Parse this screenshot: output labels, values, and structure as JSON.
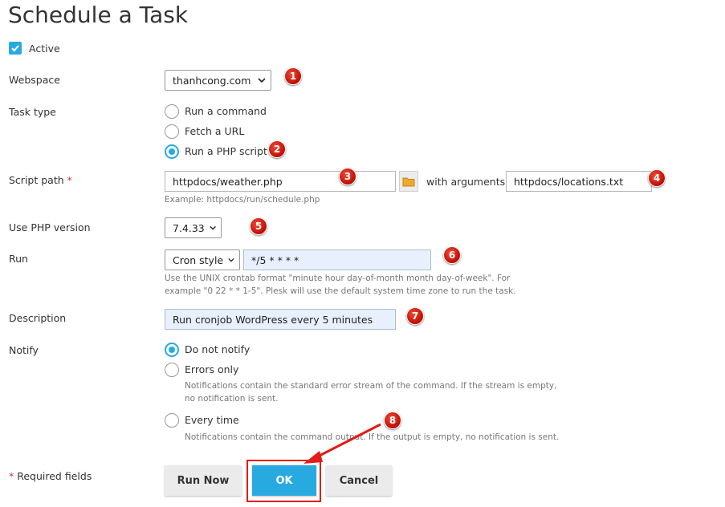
{
  "page": {
    "title": "Schedule a Task"
  },
  "active": {
    "label": "Active",
    "checked": true
  },
  "webspace": {
    "label": "Webspace",
    "value": "thanhcong.com"
  },
  "task_type": {
    "label": "Task type",
    "options": [
      "Run a command",
      "Fetch a URL",
      "Run a PHP script"
    ],
    "selected": "Run a PHP script"
  },
  "script_path": {
    "label": "Script path",
    "required_mark": "*",
    "value": "httpdocs/weather.php",
    "example": "Example: httpdocs/run/schedule.php",
    "arguments_label": "with arguments",
    "arguments_value": "httpdocs/locations.txt"
  },
  "php_version": {
    "label": "Use PHP version",
    "value": "7.4.33"
  },
  "run": {
    "label": "Run",
    "style_value": "Cron style",
    "cron_value": "*/5 * * * *",
    "hint_line1": "Use the UNIX crontab format \"minute hour day-of-month month day-of-week\". For",
    "hint_line2": "example \"0 22 * * 1-5\". Plesk will use the default system time zone to run the task."
  },
  "description": {
    "label": "Description",
    "value": "Run cronjob WordPress every 5 minutes"
  },
  "notify": {
    "label": "Notify",
    "options": {
      "none": "Do not notify",
      "errors": "Errors only",
      "errors_hint1": "Notifications contain the standard error stream of the command. If the stream is empty,",
      "errors_hint2": "no notification is sent.",
      "every": "Every time",
      "every_hint": "Notifications contain the command output. If the output is empty, no notification is sent."
    },
    "selected": "Do not notify"
  },
  "footer": {
    "required_mark": "*",
    "required_label": "Required fields",
    "run_now": "Run Now",
    "ok": "OK",
    "cancel": "Cancel"
  },
  "annotations": [
    "1",
    "2",
    "3",
    "4",
    "5",
    "6",
    "7",
    "8"
  ],
  "colors": {
    "accent": "#28aae1",
    "annotation": "#e41b17",
    "required": "#d5362b"
  }
}
